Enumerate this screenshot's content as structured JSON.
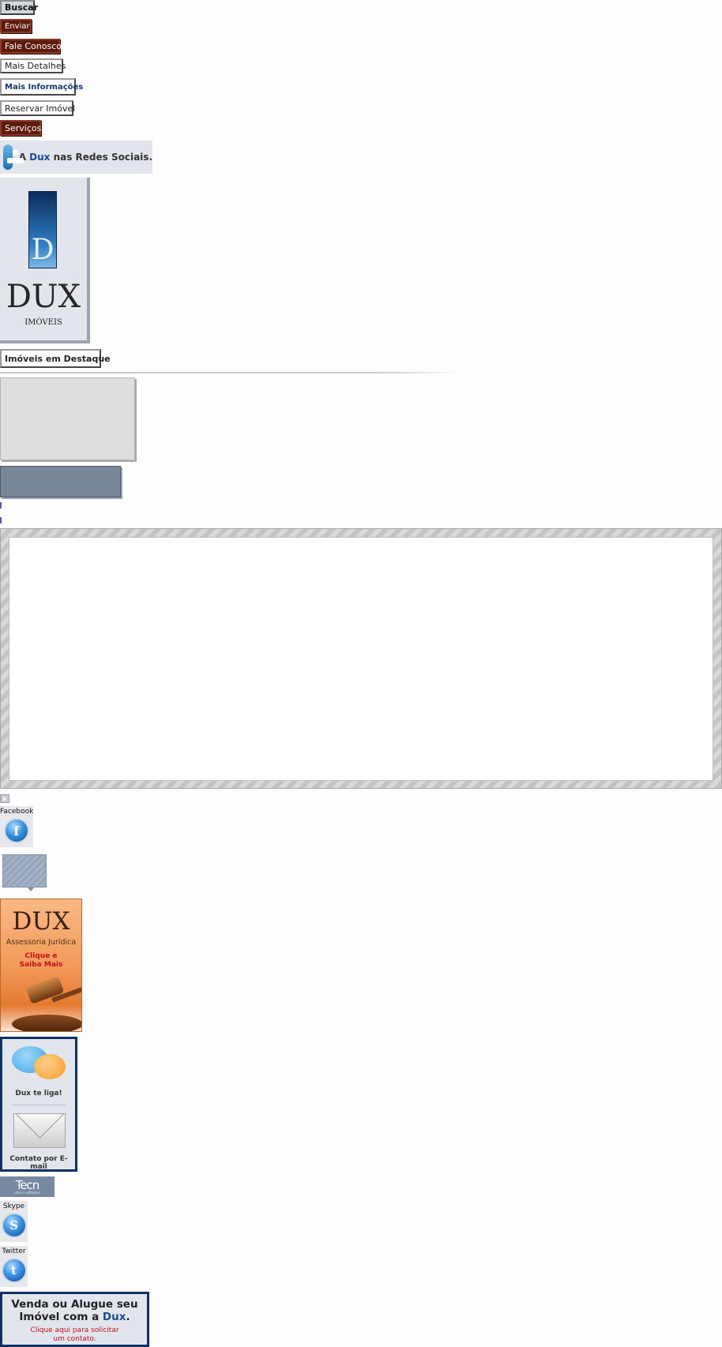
{
  "buttons": {
    "buscar": "Buscar",
    "enviar": "Enviar",
    "fale_conosco": "Fale Conosco",
    "mais_detalhes": "Mais Detalhes",
    "mais_informacoes": "Mais Informações",
    "reservar_imovel": "Reservar Imóvel",
    "servicos": "Serviços",
    "imoveis_destaque": "Imóveis em Destaque"
  },
  "redes_sociais": {
    "prefix": "A ",
    "brand": "Dux",
    "suffix": " nas Redes Sociais."
  },
  "logo": {
    "letter": "D",
    "name": "DUX",
    "sub": "IMÓVEIS"
  },
  "social": {
    "facebook": "Facebook",
    "skype": "Skype",
    "twitter": "Twitter"
  },
  "assessoria": {
    "name": "DUX",
    "subtitle": "Assessoria Jurídica",
    "cta_line1": "Clique e",
    "cta_line2": "Saiba Mais"
  },
  "contato": {
    "ligar": "Dux te liga!",
    "email": "Contato por E-mail"
  },
  "credit_logo": {
    "text": "Tecn",
    "sub": "sites e softwares"
  },
  "venda": {
    "line1": "Venda ou Alugue seu",
    "line2_prefix": "Imóvel com a ",
    "line2_brand": "Dux",
    "line2_suffix": ".",
    "cta1": "Clique aqui para solicitar",
    "cta2": "um contato."
  },
  "colors": {
    "brown": "#5e1a0b",
    "navy": "#0d3263",
    "brand_blue": "#1b4b9b",
    "cta_red": "#c8101a"
  }
}
